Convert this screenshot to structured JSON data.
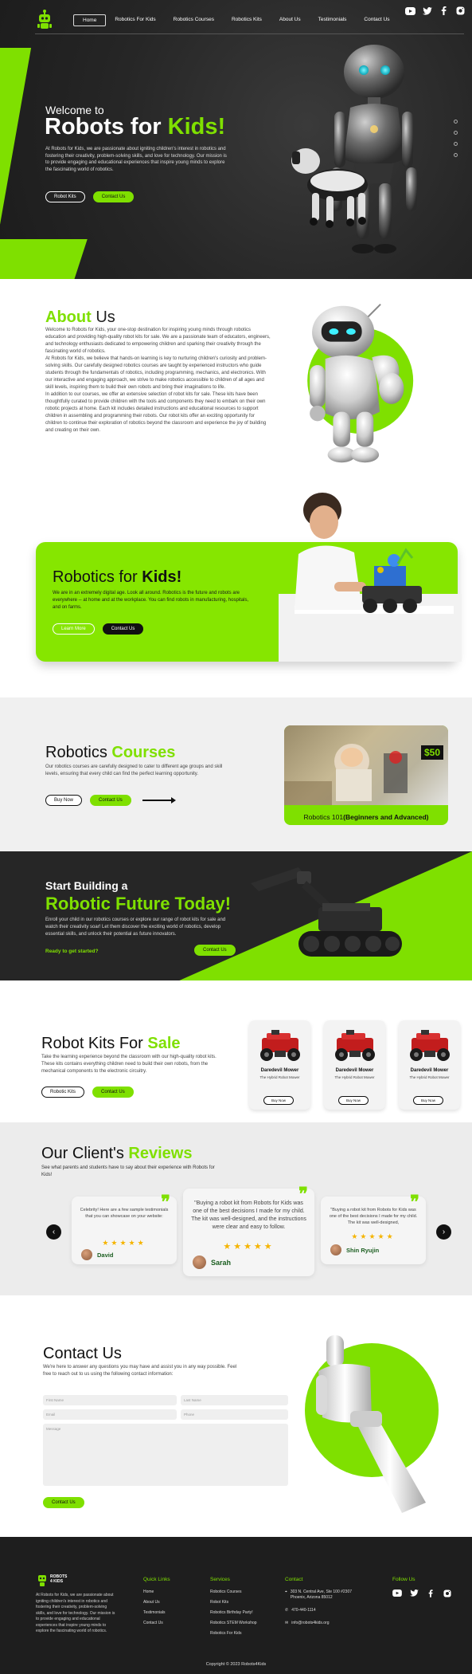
{
  "nav": {
    "items": [
      "Home",
      "Robotics For Kids",
      "Robotics Courses",
      "Robotics Kits",
      "About Us",
      "Testimonials",
      "Contact Us"
    ],
    "active_index": 0,
    "social_icons": [
      "youtube-icon",
      "twitter-icon",
      "facebook-icon",
      "instagram-icon"
    ]
  },
  "hero": {
    "welcome": "Welcome to",
    "title_part1": "Robots for ",
    "title_part2": "Kids!",
    "description": "At Robots for Kids, we are passionate about igniting children's interest in robotics and fostering their creativity, problem-solving skills, and love for technology. Our mission is to provide engaging and educational experiences that inspire young minds to explore the fascinating world of robotics.",
    "btn_kits": "Robot Kits",
    "btn_contact": "Contact Us",
    "slide_count": 4
  },
  "about": {
    "title_green": "About",
    "title_dark": " Us",
    "paragraphs": [
      "Welcome to Robots for Kids, your one-stop destination for inspiring young minds through robotics education and providing high-quality robot kits for sale. We are a passionate team of educators, engineers, and technology enthusiasts dedicated to empowering children and sparking their creativity through the fascinating world of robotics.",
      "At Robots for Kids, we believe that hands-on learning is key to nurturing children's curiosity and problem-solving skills. Our carefully designed robotics courses are taught by experienced instructors who guide students through the fundamentals of robotics, including programming, mechanics, and electronics. With our interactive and engaging approach, we strive to make robotics accessible to children of all ages and skill levels, inspiring them to build their own robots and bring their imaginations to life.",
      "In addition to our courses, we offer an extensive selection of robot kits for sale. These kits have been thoughtfully curated to provide children with the tools and components they need to embark on their own robotic projects at home. Each kit includes detailed instructions and educational resources to support children in assembling and programming their robots. Our robot kits offer an exciting opportunity for children to continue their exploration of robotics beyond the classroom and experience the joy of building and creating on their own."
    ]
  },
  "banner": {
    "title_normal": "Robotics for ",
    "title_bold": "Kids!",
    "description": "We are in an extremely digital age. Look all around. Robotics is the future and robots are everywhere -- at home and at the workplace. You can find robots in manufacturing, hospitals, and on farms.",
    "btn_learn": "Learn More",
    "btn_contact": "Contact Us"
  },
  "courses": {
    "title_normal": "Robotics ",
    "title_green": "Courses",
    "description": "Our robotics courses are carefully designed to cater to different age groups and skill levels, ensuring that every child can find the perfect learning opportunity.",
    "btn_buy": "Buy Now",
    "btn_contact": "Contact Us",
    "card_price": "$50",
    "card_label_normal": "Robotics 101",
    "card_label_bold": "(Beginners and Advanced)"
  },
  "start": {
    "title_line1": "Start Building a",
    "title_line2": "Robotic Future Today!",
    "description": "Enroll your child in our robotics courses or explore our range of robot kits for sale and watch their creativity soar! Let them discover the exciting world of robotics, develop essential skills, and unlock their potential as future innovators.",
    "ready": "Ready to get started?",
    "btn_contact": "Contact Us"
  },
  "kits": {
    "title_normal": "Robot Kits For ",
    "title_green": "Sale",
    "description": "Take the learning experience beyond the classroom with our high-quality robot kits. These kits contains everything children need to build their own robots, from the mechanical components to the electronic circuitry.",
    "btn_kits": "Robotic Kits",
    "btn_contact": "Contact Us",
    "products": [
      {
        "name": "Daredevil Mower",
        "subtitle": "The Hybrid Robot Mower",
        "button": "Buy Now"
      },
      {
        "name": "Daredevil Mower",
        "subtitle": "The Hybrid Robot Mower",
        "button": "Buy Now"
      },
      {
        "name": "Daredevil Mower",
        "subtitle": "The Hybrid Robot Mower",
        "button": "Buy Now"
      }
    ]
  },
  "reviews": {
    "title_normal": "Our Client's ",
    "title_green": "Reviews",
    "description": "See what parents and students have to say about their experience with Robots for Kids!",
    "prev_icon": "chevron-left-icon",
    "next_icon": "chevron-right-icon",
    "items": [
      {
        "text": "Celebrity! Here are a few sample testimonials that you can showcase on your website:",
        "author": "David",
        "stars": 5
      },
      {
        "text": "\"Buying a robot kit from Robots for Kids was one of the best decisions I made for my child. The kit was well-designed, and the instructions were clear and easy to follow.",
        "author": "Sarah",
        "stars": 5
      },
      {
        "text": "\"Buying a robot kit from Robots for Kids was one of the best decisions I made for my child. The kit was well-designed,",
        "author": "Shin Ryujin",
        "stars": 5
      }
    ]
  },
  "contact": {
    "title": "Contact Us",
    "description": "We're here to answer any questions you may have and assist you in any way possible. Feel free to reach out to us using the following contact information:",
    "placeholders": {
      "first_name": "First Name",
      "last_name": "Last Name",
      "email": "Email",
      "phone": "Phone",
      "message": "Message"
    },
    "btn_submit": "Contact Us"
  },
  "footer": {
    "logo_text_line1": "ROBOTS",
    "logo_text_line2": "4 KIDS",
    "about": "At Robots for Kids, we are passionate about igniting children's interest in robotics and fostering their creativity, problem-solving skills, and love for technology. Our mission is to provide engaging and educational experiences that inspire young minds to explore the fascinating world of robotics.",
    "quick_links_title": "Quick Links",
    "quick_links": [
      "Home",
      "About Us",
      "Testimonials",
      "Contact Us"
    ],
    "services_title": "Services",
    "services": [
      "Robotics Courses",
      "Robot Kits",
      "Robotics Birthday Party!",
      "Robotics STEM Workshop",
      "Robotics For Kids"
    ],
    "contact_title": "Contact",
    "address": "303 N. Central Ave, Ste 100 #2307 Phoenix, Arizona 85012",
    "phone": "470-440-1114",
    "email": "info@robots4kids.org",
    "follow_title": "Follow Us",
    "copyright": "Copyright © 2023 Robots4Kids"
  },
  "colors": {
    "accent": "#7fe000",
    "dark": "#262626",
    "light_bg": "#f0f0f0"
  }
}
